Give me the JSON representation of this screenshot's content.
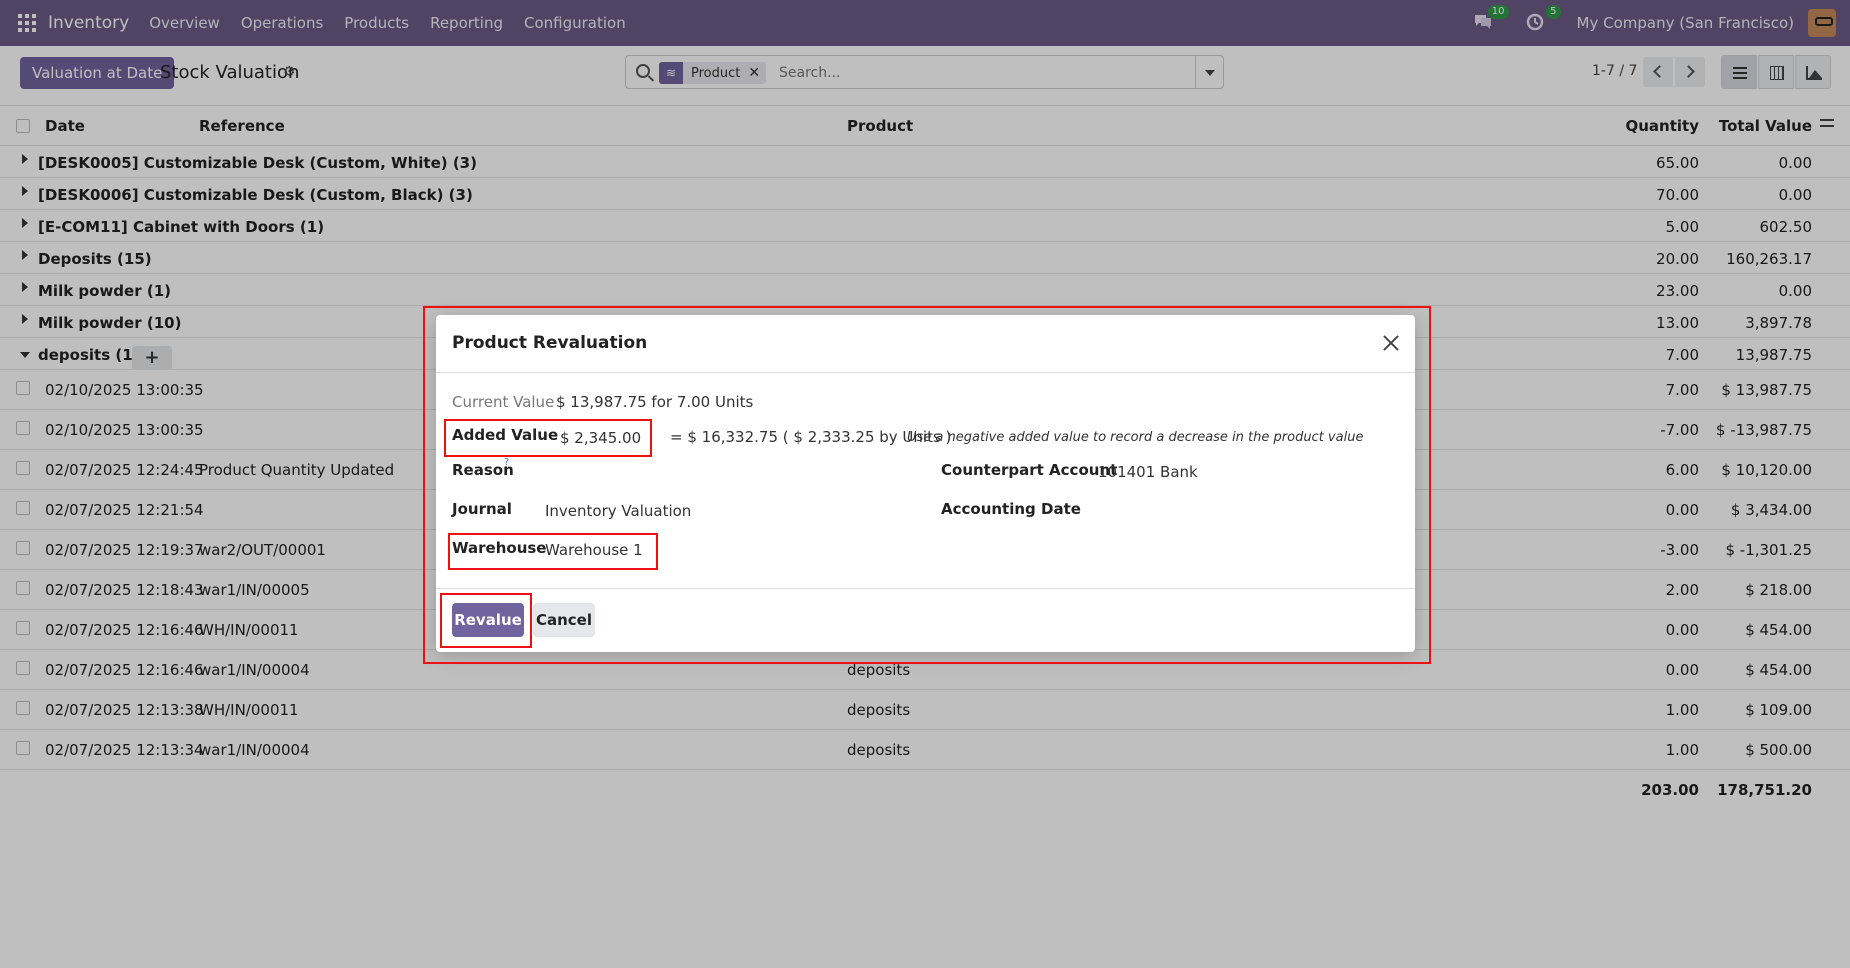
{
  "navbar": {
    "app_name": "Inventory",
    "menu": [
      "Overview",
      "Operations",
      "Products",
      "Reporting",
      "Configuration"
    ],
    "messages_badge": "10",
    "activities_badge": "5",
    "company": "My Company (San Francisco)"
  },
  "control": {
    "primary_button": "Valuation at Date",
    "title": "Stock Valuation",
    "facet_label": "Product",
    "search_placeholder": "Search...",
    "pager": "1-7 / 7"
  },
  "table": {
    "headers": {
      "date": "Date",
      "reference": "Reference",
      "product": "Product",
      "quantity": "Quantity",
      "total_value": "Total Value"
    },
    "groups": [
      {
        "label": "[DESK0005] Customizable Desk (Custom, White) (3)",
        "quantity": "65.00",
        "value": "0.00"
      },
      {
        "label": "[DESK0006] Customizable Desk (Custom, Black) (3)",
        "quantity": "70.00",
        "value": "0.00"
      },
      {
        "label": "[E-COM11] Cabinet with Doors (1)",
        "quantity": "5.00",
        "value": "602.50"
      },
      {
        "label": "Deposits (15)",
        "quantity": "20.00",
        "value": "160,263.17"
      },
      {
        "label": "Milk powder (1)",
        "quantity": "23.00",
        "value": "0.00"
      },
      {
        "label": "Milk powder (10)",
        "quantity": "13.00",
        "value": "3,897.78"
      },
      {
        "label": "deposits (10)",
        "quantity": "7.00",
        "value": "13,987.75"
      }
    ],
    "rows": [
      {
        "date": "02/10/2025 13:00:35",
        "reference": "",
        "product": "",
        "quantity": "7.00",
        "value": "$ 13,987.75"
      },
      {
        "date": "02/10/2025 13:00:35",
        "reference": "",
        "product": "",
        "quantity": "-7.00",
        "value": "$ -13,987.75"
      },
      {
        "date": "02/07/2025 12:24:45",
        "reference": "Product Quantity Updated",
        "product": "",
        "quantity": "6.00",
        "value": "$ 10,120.00"
      },
      {
        "date": "02/07/2025 12:21:54",
        "reference": "",
        "product": "",
        "quantity": "0.00",
        "value": "$ 3,434.00"
      },
      {
        "date": "02/07/2025 12:19:37",
        "reference": "war2/OUT/00001",
        "product": "",
        "quantity": "-3.00",
        "value": "$ -1,301.25"
      },
      {
        "date": "02/07/2025 12:18:43",
        "reference": "war1/IN/00005",
        "product": "",
        "quantity": "2.00",
        "value": "$ 218.00"
      },
      {
        "date": "02/07/2025 12:16:46",
        "reference": "WH/IN/00011",
        "product": "",
        "quantity": "0.00",
        "value": "$ 454.00"
      },
      {
        "date": "02/07/2025 12:16:46",
        "reference": "war1/IN/00004",
        "product": "deposits",
        "quantity": "0.00",
        "value": "$ 454.00"
      },
      {
        "date": "02/07/2025 12:13:38",
        "reference": "WH/IN/00011",
        "product": "deposits",
        "quantity": "1.00",
        "value": "$ 109.00"
      },
      {
        "date": "02/07/2025 12:13:34",
        "reference": "war1/IN/00004",
        "product": "deposits",
        "quantity": "1.00",
        "value": "$ 500.00"
      }
    ],
    "total_quantity": "203.00",
    "total_value": "178,751.20"
  },
  "modal": {
    "title": "Product Revaluation",
    "current_value_label": "Current Value",
    "current_value": "$ 13,987.75 for 7.00 Units",
    "added_value_label": "Added Value",
    "added_value": "$ 2,345.00",
    "computed": "= $ 16,332.75 ( $ 2,333.25 by Units )",
    "hint": "Use a negative added value to record a decrease in the product value",
    "reason_label": "Reason",
    "reason_help": "?",
    "counterpart_label": "Counterpart Account",
    "counterpart_value": "101401 Bank",
    "journal_label": "Journal",
    "journal_value": "Inventory Valuation",
    "accounting_date_label": "Accounting Date",
    "warehouse_label": "Warehouse",
    "warehouse_value": "Warehouse 1",
    "revalue_button": "Revalue",
    "cancel_button": "Cancel"
  },
  "colors": {
    "navbar": "#6b5a86",
    "primary": "#71639e",
    "annotation": "#ee1111"
  }
}
